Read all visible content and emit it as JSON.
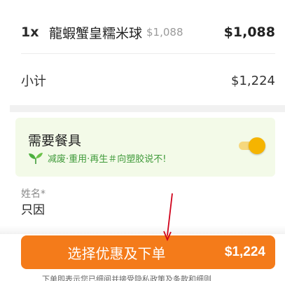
{
  "order_item": {
    "quantity": "1x",
    "name": "龍蝦蟹皇糯米球",
    "original_price": "$1,088",
    "price": "$1,088"
  },
  "subtotal": {
    "label": "小计",
    "value": "$1,224"
  },
  "utensils": {
    "title": "需要餐具",
    "note": "减废·重用·再生＃向塑胶说不!",
    "toggle_on": true,
    "icon": "leaf-icon"
  },
  "name_field": {
    "label": "姓名*",
    "value": "只因"
  },
  "checkout": {
    "label": "选择优惠及下单",
    "total": "$1,224"
  },
  "terms": "下单即表示您已细阅并接受隐私政策及条款和细则",
  "colors": {
    "accent": "#f47b1a",
    "toggle": "#f5b400",
    "green_text": "#3f9a3a",
    "card_bg": "#f3fae8",
    "annotation_arrow": "#d0021b"
  }
}
